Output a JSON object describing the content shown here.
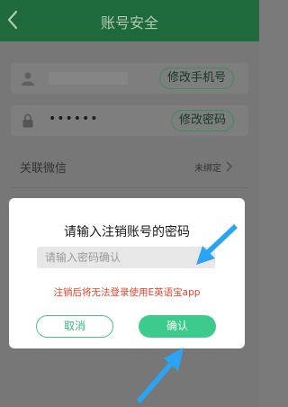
{
  "header": {
    "title": "账号安全"
  },
  "rows": {
    "phone_button": "修改手机号",
    "password_mask": "••••••",
    "password_button": "修改密码",
    "wechat_label": "关联微信",
    "wechat_status": "未绑定"
  },
  "dialog": {
    "title": "请输入注销账号的密码",
    "input_placeholder": "请输入密码确认",
    "warning": "注销后将无法登录使用E英语宝app",
    "cancel_label": "取消",
    "confirm_label": "确认"
  },
  "colors": {
    "header_bg": "#1f6a3c",
    "accent_green": "#3ccb8a",
    "warning_red": "#e0442a",
    "annotation_arrow": "#2aa4f4"
  },
  "icons": [
    "back-arrow-icon",
    "user-icon",
    "lock-icon",
    "chevron-right-icon",
    "annotation-arrow-icon"
  ]
}
